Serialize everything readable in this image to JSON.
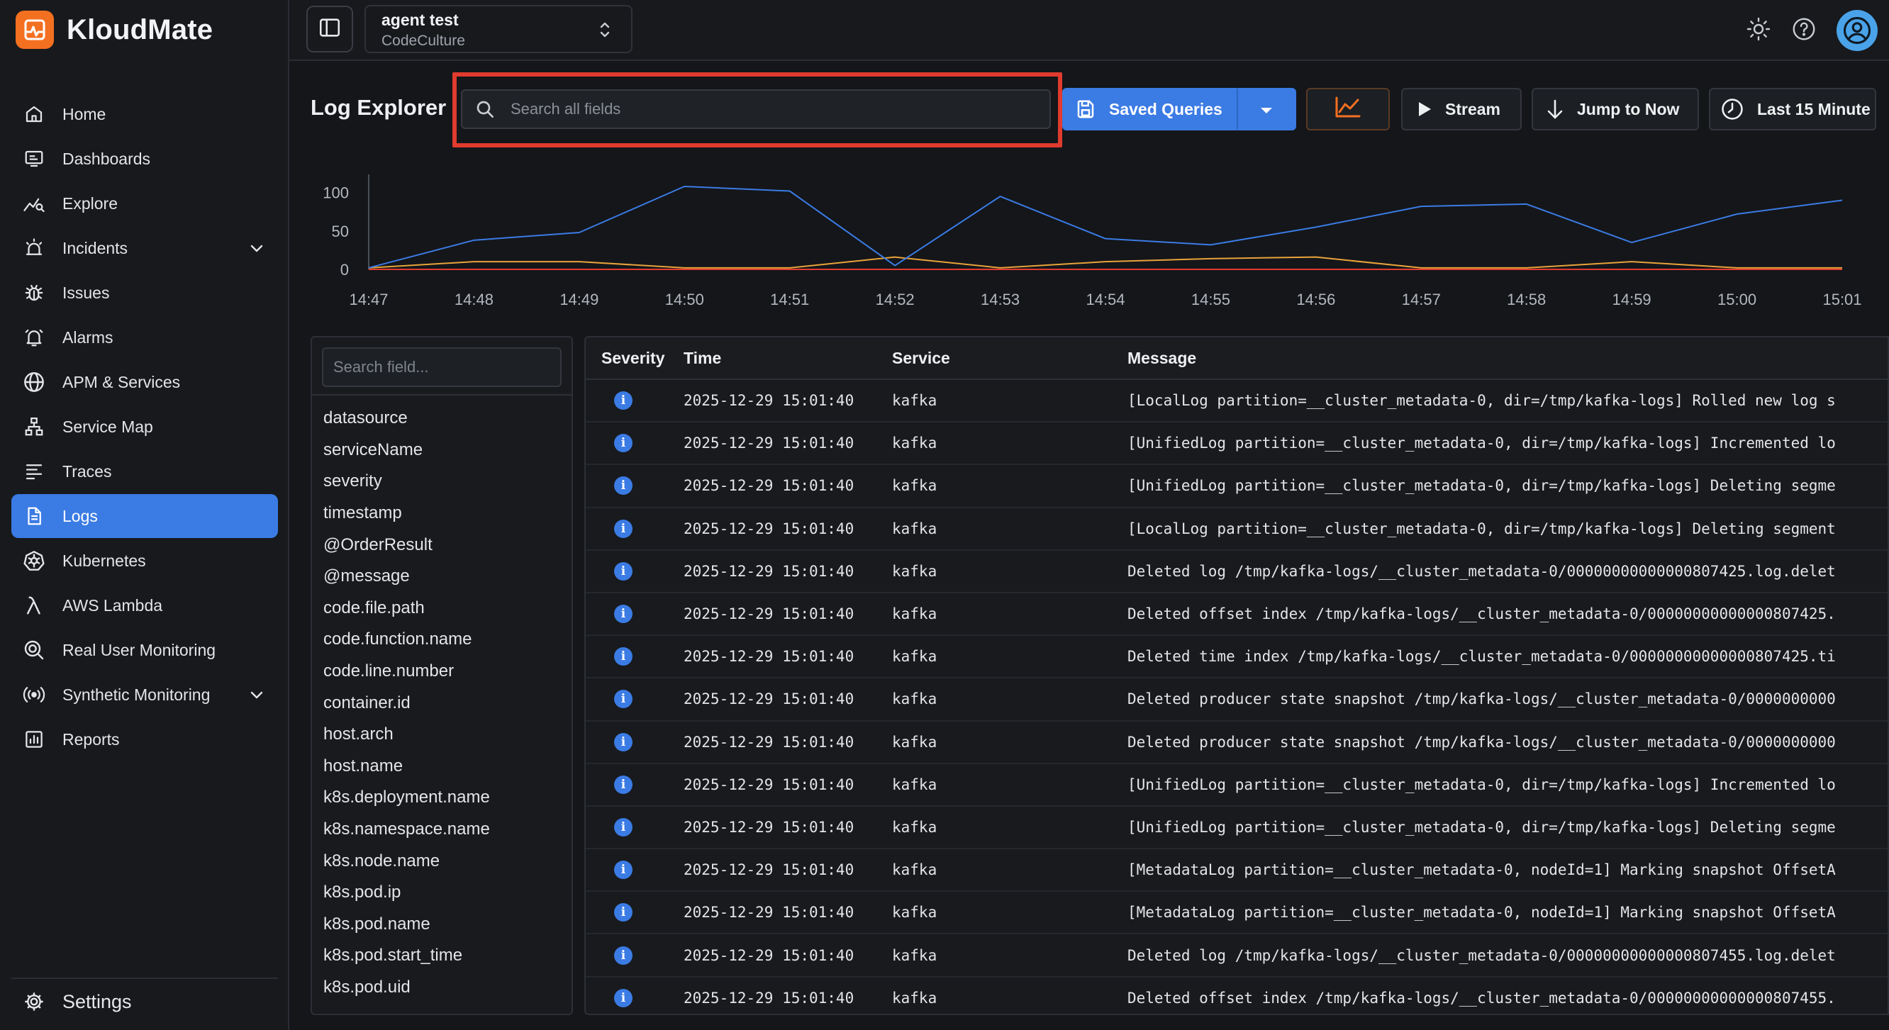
{
  "app": {
    "name": "KloudMate"
  },
  "sidebar": {
    "items": [
      {
        "label": "Home",
        "icon": "home-icon"
      },
      {
        "label": "Dashboards",
        "icon": "dashboard-icon"
      },
      {
        "label": "Explore",
        "icon": "explore-chart-icon"
      },
      {
        "label": "Incidents",
        "icon": "incident-siren-icon",
        "expandable": true
      },
      {
        "label": "Issues",
        "icon": "bug-icon"
      },
      {
        "label": "Alarms",
        "icon": "bell-icon"
      },
      {
        "label": "APM & Services",
        "icon": "globe-icon"
      },
      {
        "label": "Service Map",
        "icon": "service-map-icon"
      },
      {
        "label": "Traces",
        "icon": "traces-list-icon"
      },
      {
        "label": "Logs",
        "icon": "logs-file-icon",
        "active": true
      },
      {
        "label": "Kubernetes",
        "icon": "kubernetes-icon"
      },
      {
        "label": "AWS Lambda",
        "icon": "lambda-icon"
      },
      {
        "label": "Real User Monitoring",
        "icon": "rum-search-icon"
      },
      {
        "label": "Synthetic Monitoring",
        "icon": "broadcast-icon",
        "expandable": true
      },
      {
        "label": "Reports",
        "icon": "report-chart-icon"
      }
    ],
    "settings_label": "Settings"
  },
  "workspace": {
    "name": "agent test",
    "org": "CodeCulture"
  },
  "toolbar": {
    "title": "Log Explorer",
    "search_placeholder": "Search all fields",
    "saved_queries_label": "Saved Queries",
    "stream_label": "Stream",
    "jump_label": "Jump to Now",
    "time_range_label": "Last 15 Minute"
  },
  "colors": {
    "accent": "#3b7be4",
    "brand": "#f37021",
    "highlight": "#e03b2e",
    "series_blue": "#3b7be4",
    "series_orange": "#e8a33a",
    "series_red": "#e03b2e"
  },
  "chart_data": {
    "type": "line",
    "x": [
      "14:47",
      "14:48",
      "14:49",
      "14:50",
      "14:51",
      "14:52",
      "14:53",
      "14:54",
      "14:55",
      "14:56",
      "14:57",
      "14:58",
      "14:59",
      "15:00",
      "15:01"
    ],
    "yticks": [
      0,
      50,
      100
    ],
    "ylim": [
      0,
      120
    ],
    "grid": false,
    "series": [
      {
        "color": "#3b7be4",
        "values": [
          2,
          38,
          48,
          108,
          102,
          5,
          95,
          40,
          32,
          55,
          82,
          85,
          35,
          72,
          90
        ]
      },
      {
        "color": "#e8a33a",
        "values": [
          2,
          10,
          10,
          2,
          2,
          16,
          2,
          10,
          14,
          16,
          2,
          2,
          10,
          2,
          2
        ]
      },
      {
        "color": "#e03b2e",
        "values": [
          0,
          0,
          0,
          0,
          0,
          0,
          0,
          0,
          0,
          0,
          0,
          0,
          0,
          0,
          0
        ]
      }
    ]
  },
  "fields": {
    "search_placeholder": "Search field...",
    "items": [
      "datasource",
      "serviceName",
      "severity",
      "timestamp",
      "@OrderResult",
      "@message",
      "code.file.path",
      "code.function.name",
      "code.line.number",
      "container.id",
      "host.arch",
      "host.name",
      "k8s.deployment.name",
      "k8s.namespace.name",
      "k8s.node.name",
      "k8s.pod.ip",
      "k8s.pod.name",
      "k8s.pod.start_time",
      "k8s.pod.uid"
    ]
  },
  "logs": {
    "columns": [
      "Severity",
      "Time",
      "Service",
      "Message"
    ],
    "rows": [
      {
        "severity": "info",
        "time": "2025-12-29 15:01:40",
        "service": "kafka",
        "message": "[LocalLog partition=__cluster_metadata-0, dir=/tmp/kafka-logs] Rolled new log s"
      },
      {
        "severity": "info",
        "time": "2025-12-29 15:01:40",
        "service": "kafka",
        "message": "[UnifiedLog partition=__cluster_metadata-0, dir=/tmp/kafka-logs] Incremented lo"
      },
      {
        "severity": "info",
        "time": "2025-12-29 15:01:40",
        "service": "kafka",
        "message": "[UnifiedLog partition=__cluster_metadata-0, dir=/tmp/kafka-logs] Deleting segme"
      },
      {
        "severity": "info",
        "time": "2025-12-29 15:01:40",
        "service": "kafka",
        "message": "[LocalLog partition=__cluster_metadata-0, dir=/tmp/kafka-logs] Deleting segment"
      },
      {
        "severity": "info",
        "time": "2025-12-29 15:01:40",
        "service": "kafka",
        "message": "Deleted log /tmp/kafka-logs/__cluster_metadata-0/00000000000000807425.log.delet"
      },
      {
        "severity": "info",
        "time": "2025-12-29 15:01:40",
        "service": "kafka",
        "message": "Deleted offset index /tmp/kafka-logs/__cluster_metadata-0/00000000000000807425."
      },
      {
        "severity": "info",
        "time": "2025-12-29 15:01:40",
        "service": "kafka",
        "message": "Deleted time index /tmp/kafka-logs/__cluster_metadata-0/00000000000000807425.ti"
      },
      {
        "severity": "info",
        "time": "2025-12-29 15:01:40",
        "service": "kafka",
        "message": "Deleted producer state snapshot /tmp/kafka-logs/__cluster_metadata-0/0000000000"
      },
      {
        "severity": "info",
        "time": "2025-12-29 15:01:40",
        "service": "kafka",
        "message": "Deleted producer state snapshot /tmp/kafka-logs/__cluster_metadata-0/0000000000"
      },
      {
        "severity": "info",
        "time": "2025-12-29 15:01:40",
        "service": "kafka",
        "message": "[UnifiedLog partition=__cluster_metadata-0, dir=/tmp/kafka-logs] Incremented lo"
      },
      {
        "severity": "info",
        "time": "2025-12-29 15:01:40",
        "service": "kafka",
        "message": "[UnifiedLog partition=__cluster_metadata-0, dir=/tmp/kafka-logs] Deleting segme"
      },
      {
        "severity": "info",
        "time": "2025-12-29 15:01:40",
        "service": "kafka",
        "message": "[MetadataLog partition=__cluster_metadata-0, nodeId=1] Marking snapshot OffsetA"
      },
      {
        "severity": "info",
        "time": "2025-12-29 15:01:40",
        "service": "kafka",
        "message": "[MetadataLog partition=__cluster_metadata-0, nodeId=1] Marking snapshot OffsetA"
      },
      {
        "severity": "info",
        "time": "2025-12-29 15:01:40",
        "service": "kafka",
        "message": "Deleted log /tmp/kafka-logs/__cluster_metadata-0/00000000000000807455.log.delet"
      },
      {
        "severity": "info",
        "time": "2025-12-29 15:01:40",
        "service": "kafka",
        "message": "Deleted offset index /tmp/kafka-logs/__cluster_metadata-0/00000000000000807455."
      }
    ]
  }
}
